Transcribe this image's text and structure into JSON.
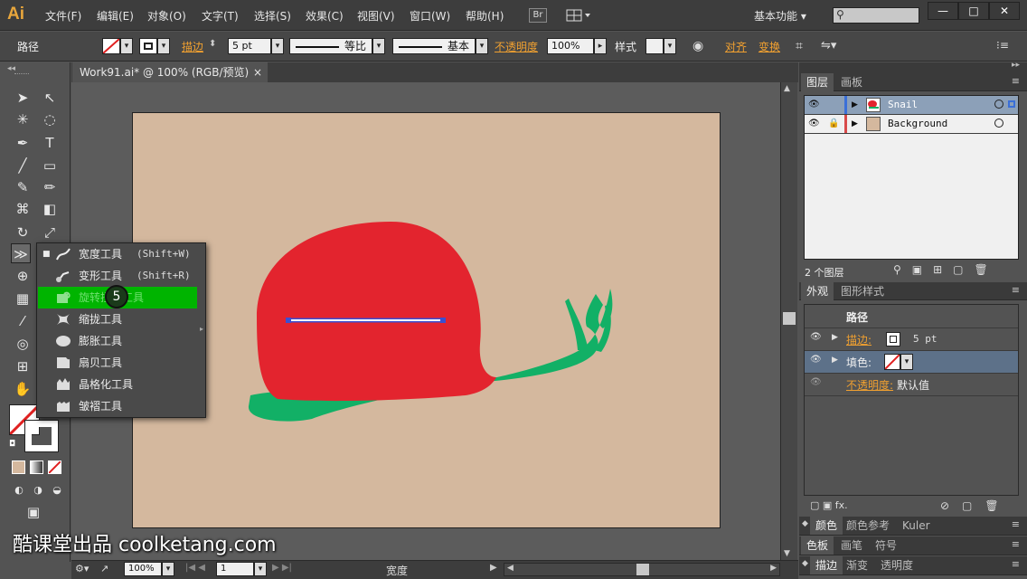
{
  "app": {
    "logo": "Ai",
    "workspace": "基本功能",
    "search_placeholder": ""
  },
  "menu": [
    "文件(F)",
    "编辑(E)",
    "对象(O)",
    "文字(T)",
    "选择(S)",
    "效果(C)",
    "视图(V)",
    "窗口(W)",
    "帮助(H)"
  ],
  "menu_extra": {
    "bridge": "Br"
  },
  "window_buttons": {
    "minimize": "—",
    "maximize": "□",
    "close": "✕"
  },
  "control": {
    "object_type": "路径",
    "stroke_label": "描边",
    "stroke_value": "5 pt",
    "profile_label": "等比",
    "brush_label": "基本",
    "opacity_label": "不透明度",
    "opacity_value": "100%",
    "style_label": "样式",
    "align_label": "对齐",
    "transform_label": "变换"
  },
  "document": {
    "tab_title": "Work91.ai* @ 100% (RGB/预览)",
    "tab_close": "×"
  },
  "status": {
    "zoom": "100%",
    "page": "1",
    "status_label": "宽度"
  },
  "flyout": {
    "items": [
      {
        "label": "宽度工具",
        "shortcut": "(Shift+W)",
        "selected": true
      },
      {
        "label": "变形工具",
        "shortcut": "(Shift+R)"
      },
      {
        "label": "旋转扭曲工具",
        "shortcut": ""
      },
      {
        "label": "缩拢工具",
        "shortcut": ""
      },
      {
        "label": "膨胀工具",
        "shortcut": ""
      },
      {
        "label": "扇贝工具",
        "shortcut": ""
      },
      {
        "label": "晶格化工具",
        "shortcut": ""
      },
      {
        "label": "皱褶工具",
        "shortcut": ""
      }
    ],
    "step_badge": "5"
  },
  "layers_panel": {
    "tabs": [
      "图层",
      "画板"
    ],
    "layers": [
      {
        "name": "Snail",
        "color": "#3a6fd8"
      },
      {
        "name": "Background",
        "color": "#d84a4a"
      }
    ],
    "count": "2 个图层"
  },
  "appearance_panel": {
    "tabs": [
      "外观",
      "图形样式"
    ],
    "title": "路径",
    "stroke_label": "描边:",
    "stroke_value": "5 pt",
    "fill_label": "填色:",
    "opacity_label": "不透明度:",
    "opacity_value": "默认值",
    "fx": "fx."
  },
  "bottom_panels": [
    {
      "tabs": [
        "颜色",
        "颜色参考",
        "Kuler"
      ]
    },
    {
      "tabs": [
        "色板",
        "画笔",
        "符号"
      ]
    },
    {
      "tabs": [
        "描边",
        "渐变",
        "透明度"
      ]
    }
  ],
  "watermark": "酷课堂出品 coolketang.com",
  "colors": {
    "snail_shell": "#e3242e",
    "snail_body": "#12b066",
    "artboard": "#d4b89e",
    "highlight": "#00b400",
    "accent": "#f0a030"
  }
}
